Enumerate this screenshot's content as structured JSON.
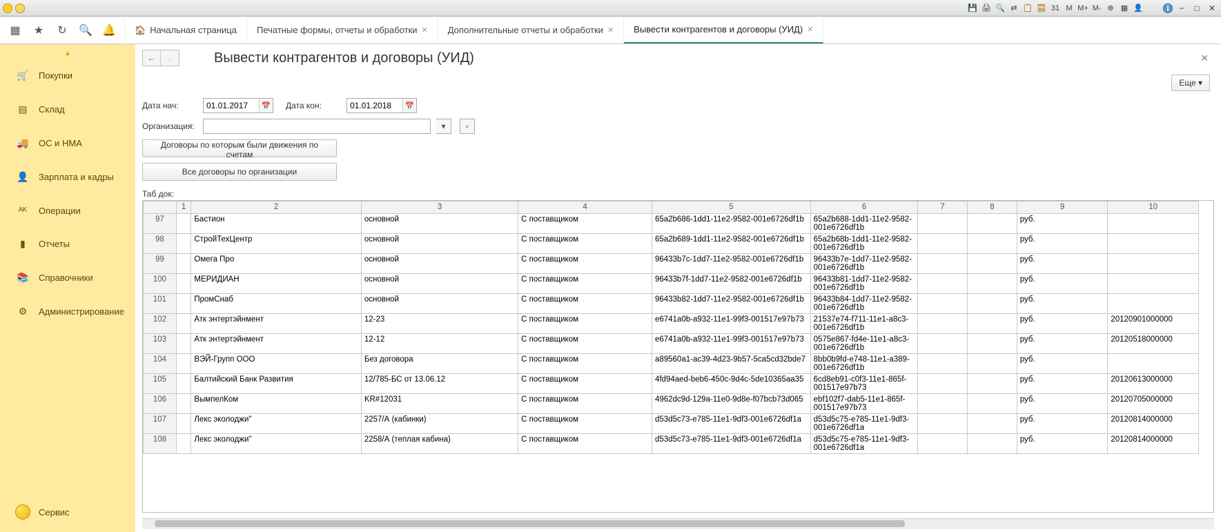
{
  "tabs": {
    "home": "Начальная страница",
    "print": "Печатные формы, отчеты и обработки",
    "extra": "Дополнительные отчеты и обработки",
    "active": "Вывести контрагентов и договоры (УИД)"
  },
  "sidebar": {
    "items": [
      {
        "icon": "🛒",
        "label": "Покупки"
      },
      {
        "icon": "▤",
        "label": "Склад"
      },
      {
        "icon": "🚚",
        "label": "ОС и НМА"
      },
      {
        "icon": "👤",
        "label": "Зарплата и кадры"
      },
      {
        "icon": "ᴬᴷ",
        "label": "Операции"
      },
      {
        "icon": "▮",
        "label": "Отчеты"
      },
      {
        "icon": "📚",
        "label": "Справочники"
      },
      {
        "icon": "⚙",
        "label": "Администрирование"
      }
    ],
    "service": "Сервис"
  },
  "page": {
    "title": "Вывести контрагентов и договоры (УИД)",
    "more": "Еще ▾",
    "date_start_label": "Дата нач:",
    "date_end_label": "Дата кон:",
    "date_start": "01.01.2017",
    "date_end": "01.01.2018",
    "org_label": "Организация:",
    "org_value": "",
    "btn_contracts_with_moves": "Договоры по которым были движения по счетам",
    "btn_all_contracts": "Все договоры по организации",
    "tab_doc": "Таб док:"
  },
  "grid": {
    "columns": [
      "",
      "1",
      "2",
      "3",
      "4",
      "5",
      "6",
      "7",
      "8",
      "9",
      "10"
    ],
    "rows": [
      {
        "n": "97",
        "c2": "Бастион",
        "c3": "основной",
        "c4": "С поставщиком",
        "c5": "65a2b686-1dd1-11e2-9582-001e6726df1b",
        "c6": "65a2b688-1dd1-11e2-9582-001e6726df1b",
        "c7": "",
        "c8": "",
        "c9": "руб.",
        "c10": ""
      },
      {
        "n": "98",
        "c2": "СтройТехЦентр",
        "c3": "основной",
        "c4": "С поставщиком",
        "c5": "65a2b689-1dd1-11e2-9582-001e6726df1b",
        "c6": "65a2b68b-1dd1-11e2-9582-001e6726df1b",
        "c7": "",
        "c8": "",
        "c9": "руб.",
        "c10": ""
      },
      {
        "n": "99",
        "c2": "Омега Про",
        "c3": "основной",
        "c4": "С поставщиком",
        "c5": "96433b7c-1dd7-11e2-9582-001e6726df1b",
        "c6": "96433b7e-1dd7-11e2-9582-001e6726df1b",
        "c7": "",
        "c8": "",
        "c9": "руб.",
        "c10": ""
      },
      {
        "n": "100",
        "c2": "МЕРИДИАН",
        "c3": "основной",
        "c4": "С поставщиком",
        "c5": "96433b7f-1dd7-11e2-9582-001e6726df1b",
        "c6": "96433b81-1dd7-11e2-9582-001e6726df1b",
        "c7": "",
        "c8": "",
        "c9": "руб.",
        "c10": ""
      },
      {
        "n": "101",
        "c2": "ПромСнаб",
        "c3": "основной",
        "c4": "С поставщиком",
        "c5": "96433b82-1dd7-11e2-9582-001e6726df1b",
        "c6": "96433b84-1dd7-11e2-9582-001e6726df1b",
        "c7": "",
        "c8": "",
        "c9": "руб.",
        "c10": ""
      },
      {
        "n": "102",
        "c2": "Атк энтертэйнмент",
        "c3": "12-23",
        "c4": "С поставщиком",
        "c5": "e6741a0b-a932-11e1-99f3-001517e97b73",
        "c6": "21537e74-f711-11e1-a8c3-001e6726df1b",
        "c7": "",
        "c8": "",
        "c9": "руб.",
        "c10": "20120901000000"
      },
      {
        "n": "103",
        "c2": "Атк энтертэйнмент",
        "c3": "12-12",
        "c4": "С поставщиком",
        "c5": "e6741a0b-a932-11e1-99f3-001517e97b73",
        "c6": "0575e867-fd4e-11e1-a8c3-001e6726df1b",
        "c7": "",
        "c8": "",
        "c9": "руб.",
        "c10": "20120518000000"
      },
      {
        "n": "104",
        "c2": "ВЭЙ-Групп ООО",
        "c3": "Без договора",
        "c4": "С поставщиком",
        "c5": "a89560a1-ac39-4d23-9b57-5ca5cd32bde7",
        "c6": "8bb0b9fd-e748-11e1-a389-001e6726df1b",
        "c7": "",
        "c8": "",
        "c9": "руб.",
        "c10": ""
      },
      {
        "n": "105",
        "c2": "Балтийский Банк Развития",
        "c3": "12/785-БС от 13.06.12",
        "c4": "С поставщиком",
        "c5": "4fd94aed-beb6-450c-9d4c-5de10365aa35",
        "c6": "6cd8eb91-c0f3-11e1-865f-001517e97b73",
        "c7": "",
        "c8": "",
        "c9": "руб.",
        "c10": "20120613000000"
      },
      {
        "n": "106",
        "c2": "ВымпелКом",
        "c3": "KR#12031",
        "c4": "С поставщиком",
        "c5": "4962dc9d-129a-11e0-9d8e-f07bcb73d065",
        "c6": "ebf102f7-dab5-11e1-865f-001517e97b73",
        "c7": "",
        "c8": "",
        "c9": "руб.",
        "c10": "20120705000000"
      },
      {
        "n": "107",
        "c2": "Лекс эколоджи\"",
        "c3": "2257/А (кабинки)",
        "c4": "С поставщиком",
        "c5": "d53d5c73-e785-11e1-9df3-001e6726df1a",
        "c6": "d53d5c75-e785-11e1-9df3-001e6726df1a",
        "c7": "",
        "c8": "",
        "c9": "руб.",
        "c10": "20120814000000"
      },
      {
        "n": "108",
        "c2": "Лекс эколоджи\"",
        "c3": "2258/А (теплая кабина)",
        "c4": "С поставщиком",
        "c5": "d53d5c73-e785-11e1-9df3-001e6726df1a",
        "c6": "d53d5c75-e785-11e1-9df3-001e6726df1a",
        "c7": "",
        "c8": "",
        "c9": "руб.",
        "c10": "20120814000000"
      }
    ]
  }
}
